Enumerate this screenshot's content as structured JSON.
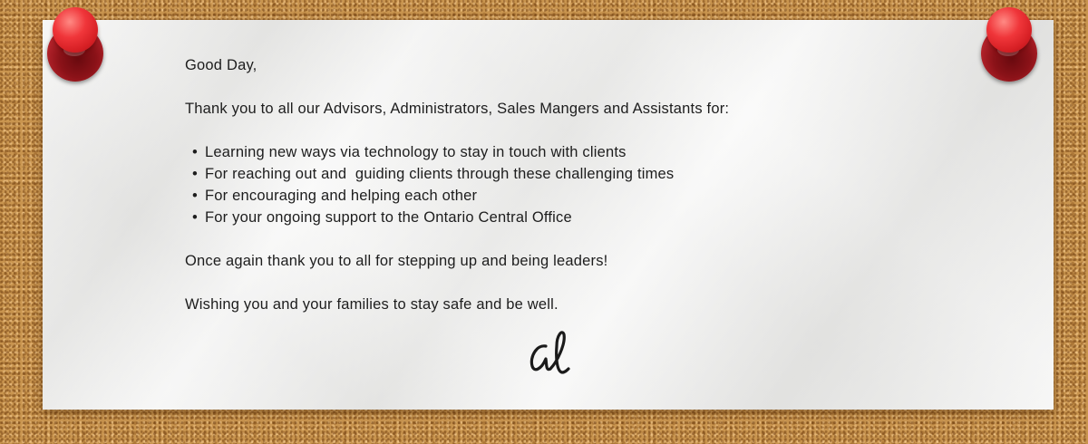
{
  "letter": {
    "greeting": "Good Day,",
    "intro": "Thank you to all our Advisors, Administrators, Sales Mangers and Assistants for:",
    "bullets": [
      "Learning new ways via technology to stay in touch with clients",
      "For reaching out and  guiding clients through these challenging times",
      "For encouraging and helping each other",
      "For your ongoing support to the Ontario Central Office"
    ],
    "closing_1": "Once again thank you to all for stepping up and being leaders!",
    "closing_2": "Wishing you and your families to stay safe and be well.",
    "signature": "al"
  },
  "colors": {
    "cork": "#c9954f",
    "paper": "#f1f1f0",
    "pin_red": "#e5282e",
    "text": "#1d1d1d"
  },
  "icons": {
    "left_pin": "pushpin-icon",
    "right_pin": "pushpin-icon"
  }
}
